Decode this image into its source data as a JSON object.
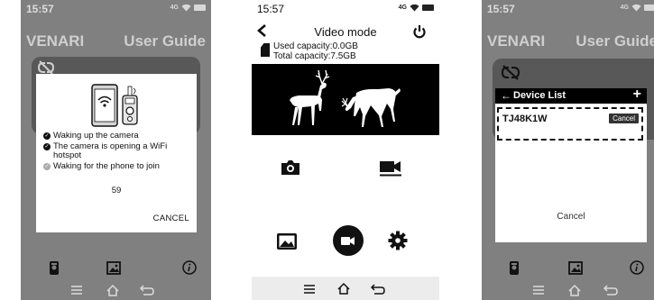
{
  "screen1": {
    "status": {
      "time": "15:57",
      "net": "4G"
    },
    "header": {
      "brand": "VENARI",
      "guide": "User Guide"
    },
    "dialog": {
      "steps": [
        {
          "text": "Waking up the camera",
          "state": "done"
        },
        {
          "text": "The camera is opening a WiFi hotspot",
          "state": "done"
        },
        {
          "text": "Waking for the phone to join",
          "state": "pending"
        }
      ],
      "countdown": "59",
      "cancel": "CANCEL"
    }
  },
  "screen2": {
    "status": {
      "time": "15:57",
      "net": "4G"
    },
    "title": "Video mode",
    "used_capacity": "Used capacity:0.0GB",
    "total_capacity": "Total capacity:7.5GB"
  },
  "screen3": {
    "status": {
      "time": "15:57",
      "net": "4G"
    },
    "header": {
      "brand": "VENARI",
      "guide": "User Guide"
    },
    "device_list": {
      "title": "Device List",
      "back": "←",
      "add": "+",
      "devices": [
        {
          "name": "TJ48K1W",
          "action": "Cancel"
        }
      ],
      "cancel": "Cancel"
    }
  },
  "colors": {
    "dim_bg": "#808080",
    "dim_card": "#585858",
    "dark": "#111111"
  }
}
